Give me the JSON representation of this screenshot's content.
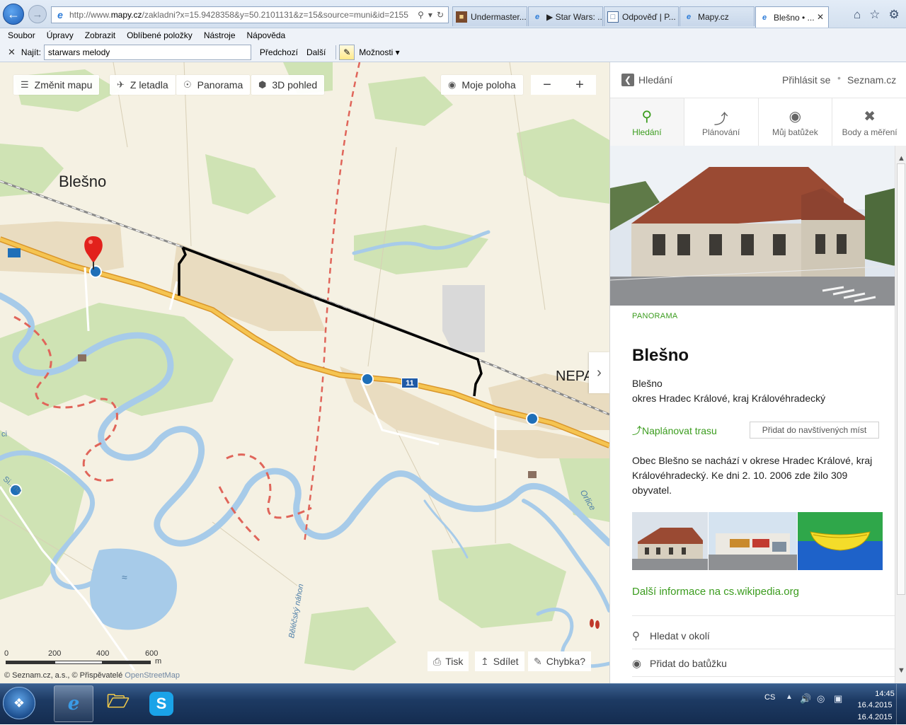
{
  "browser": {
    "address": {
      "prefix": "http://www.",
      "domain": "mapy.cz",
      "rest": "/zakladni?x=15.9428358&y=50.2101131&z=15&source=muni&id=2155"
    },
    "tabs": [
      {
        "label": "Undermaster...",
        "icon": "image-favicon"
      },
      {
        "label": "▶ Star Wars: ...",
        "icon": "ie-favicon"
      },
      {
        "label": "Odpověď | P...",
        "icon": "page-favicon"
      },
      {
        "label": "Mapy.cz",
        "icon": "ie-favicon"
      },
      {
        "label": "Blešno • ...",
        "icon": "ie-favicon",
        "active": true
      }
    ],
    "menu": [
      "Soubor",
      "Úpravy",
      "Zobrazit",
      "Oblíbené položky",
      "Nástroje",
      "Nápověda"
    ],
    "find": {
      "label": "Najít:",
      "value": "starwars melody",
      "prev": "Předchozí",
      "next": "Další",
      "options": "Možnosti"
    }
  },
  "map": {
    "buttons": {
      "change_map": "Změnit mapu",
      "aerial": "Z letadla",
      "panorama": "Panorama",
      "view3d": "3D pohled",
      "my_location": "Moje poloha",
      "zoom_out": "−",
      "zoom_in": "+"
    },
    "labels": {
      "town": "Blešno",
      "nepa": "NEPA",
      "road": "11",
      "river_orlice": "Orlice",
      "stream": "Běléčský náhon",
      "corner": "Si...na",
      "edge": "ci"
    },
    "scale": {
      "ticks": [
        "0",
        "200",
        "400",
        "600"
      ],
      "unit": "m"
    },
    "copyright": {
      "text": "© Seznam.cz, a.s., © Přispěvatelé",
      "osm": "OpenStreetMap"
    },
    "bottom": {
      "print": "Tisk",
      "share": "Sdílet",
      "error": "Chybka?"
    }
  },
  "sidebar": {
    "back_label": "Hledání",
    "login": "Přihlásit se",
    "brand": "Seznam.cz",
    "tabs": [
      {
        "label": "Hledání",
        "icon": "search-icon",
        "active": true
      },
      {
        "label": "Plánování",
        "icon": "route-icon"
      },
      {
        "label": "Můj batůžek",
        "icon": "backpack-icon"
      },
      {
        "label": "Body a měření",
        "icon": "measure-icon"
      }
    ],
    "panorama_label": "PANORAMA",
    "title": "Blešno",
    "subtitle1": "Blešno",
    "subtitle2": "okres Hradec Králové, kraj Královéhradecký",
    "plan_route": "Naplánovat trasu",
    "add_visited": "Přidat do navštívených míst",
    "description": "Obec Blešno se nachází v okrese Hradec Králové, kraj Královéhradecký. Ke dni 2. 10. 2006 zde žilo 309 obyvatel.",
    "wiki_link": "Další informace na cs.wikipedia.org",
    "search_nearby": "Hledat v okolí",
    "add_backpack": "Přidat do batůžku"
  },
  "taskbar": {
    "lang": "CS",
    "time": "14:45",
    "date": "16.4.2015",
    "date_dup": "16.4.2015"
  },
  "colors": {
    "accent_green": "#3b9c1e",
    "map_bg": "#f5f1e3",
    "forest": "#cfe3b4",
    "water": "#a7cbe9",
    "road": "#f2b43a",
    "route": "#000000"
  }
}
